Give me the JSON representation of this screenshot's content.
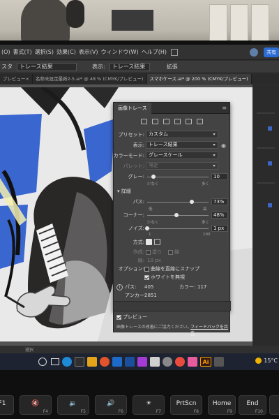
{
  "app": {
    "menu": [
      "(O)",
      "書式(T)",
      "選択(S)",
      "効果(C)",
      "表示(V)",
      "ウィンドウ(W)",
      "ヘルプ(H)"
    ],
    "share_label": "共有",
    "options_bar": {
      "preset_label": "スタ",
      "preset_value": "トレース結果",
      "view_label": "表示:",
      "view_value": "トレース結果",
      "expand_label": "拡張"
    },
    "tabs": [
      "プレビュー×",
      "名称未設定最新2-5.ai* @ 48 % (CMYK/プレビュー)",
      "スマホケース.ai* @ 200 % (CMYK/プレビュー)"
    ],
    "status": "選択"
  },
  "trace_panel": {
    "tab": "画像トレース",
    "preset": {
      "label": "プリセット:",
      "value": "カスタム"
    },
    "view": {
      "label": "表示:",
      "value": "トレース結果"
    },
    "mode": {
      "label": "カラーモード:",
      "value": "グレースケール"
    },
    "palette": {
      "label": "パレット:",
      "value": "限定"
    },
    "gray": {
      "label": "グレー:",
      "value": "10",
      "min_hint": "少なく",
      "max_hint": "多く",
      "level": 0.1
    },
    "advanced": {
      "label": "詳細"
    },
    "path": {
      "label": "パス:",
      "value": "73%",
      "min_hint": "低",
      "max_hint": "高",
      "level": 0.73
    },
    "corner": {
      "label": "コーナー:",
      "value": "48%",
      "min_hint": "少なく",
      "max_hint": "多く",
      "level": 0.48
    },
    "noise": {
      "label": "ノイズ:",
      "value": "1 px",
      "min_hint": "1",
      "max_hint": "100",
      "level": 0.0
    },
    "method": {
      "label": "方式:"
    },
    "create": {
      "label": "作成:",
      "value": "塗り",
      "stroke_label": "線"
    },
    "stroke": {
      "label": "線:",
      "value": "10 px"
    },
    "options": {
      "label": "オプション:",
      "snap": "曲線を直線にスナップ",
      "ignore_white": "ホワイトを無視"
    },
    "stats": {
      "paths_label": "パス:",
      "paths": "405",
      "colors_label": "カラー:",
      "colors": "117",
      "anchors_label": "アンカー:",
      "anchors": "2851"
    },
    "preview": "プレビュー",
    "footer_left": "画像トレースの改善にご協力ください。",
    "footer_link": "フィードバックを共有"
  },
  "taskbar": {
    "weather": "15°C"
  },
  "keyboard": {
    "keys": [
      {
        "label": "F1",
        "fn": ""
      },
      {
        "label": "🔇",
        "fn": "F4"
      },
      {
        "label": "🔉",
        "fn": "F5"
      },
      {
        "label": "🔊",
        "fn": "F6"
      },
      {
        "label": "☀",
        "fn": "F7"
      },
      {
        "label": "PrtScn",
        "fn": "F8"
      },
      {
        "label": "Home",
        "fn": "F9"
      },
      {
        "label": "End",
        "fn": "F10"
      },
      {
        "label": "",
        "fn": ""
      }
    ]
  }
}
